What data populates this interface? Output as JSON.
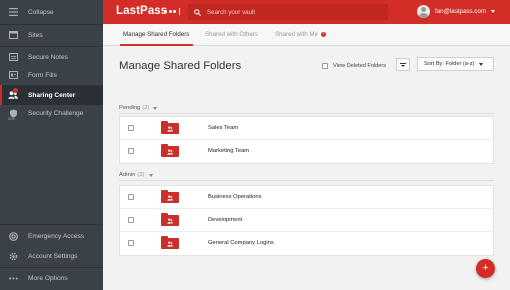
{
  "app": {
    "logo": "LastPass"
  },
  "search": {
    "placeholder": "Search your vault"
  },
  "user": {
    "email": "fan@lastpass.com"
  },
  "sidebar": {
    "items": [
      {
        "label": "Collapse",
        "icon": "collapse-icon"
      },
      {
        "label": "Sites",
        "icon": "sites-icon"
      },
      {
        "label": "Secure Notes",
        "icon": "notes-icon"
      },
      {
        "label": "Form Fills",
        "icon": "form-fills-icon"
      },
      {
        "label": "Sharing Center",
        "icon": "sharing-icon",
        "active": true
      },
      {
        "label": "Security Challenge",
        "icon": "security-challenge-icon",
        "percent": "61%"
      },
      {
        "label": "Emergency Access",
        "icon": "emergency-icon"
      },
      {
        "label": "Account Settings",
        "icon": "gear-icon"
      },
      {
        "label": "More Options",
        "icon": "more-icon"
      }
    ]
  },
  "tabs": [
    {
      "label": "Manage Shared Folders",
      "active": true
    },
    {
      "label": "Shared with Others"
    },
    {
      "label": "Shared with Me",
      "badge": "!"
    }
  ],
  "main": {
    "title": "Manage Shared Folders",
    "show_deleted_label": "View Deleted Folders",
    "sort_label": "Sort By: Folder (a-z)"
  },
  "groups": [
    {
      "label": "Pending",
      "count": "(2)",
      "folders": [
        "Sales Team",
        "Marketing Team"
      ]
    },
    {
      "label": "Admin",
      "count": "(3)",
      "folders": [
        "Business Operations",
        "Development",
        "General Company Logins"
      ]
    }
  ],
  "fab": {
    "label": "+"
  },
  "colors": {
    "accent": "#d32d27",
    "sidebar": "#3a4148",
    "folder": "#c9302c"
  }
}
